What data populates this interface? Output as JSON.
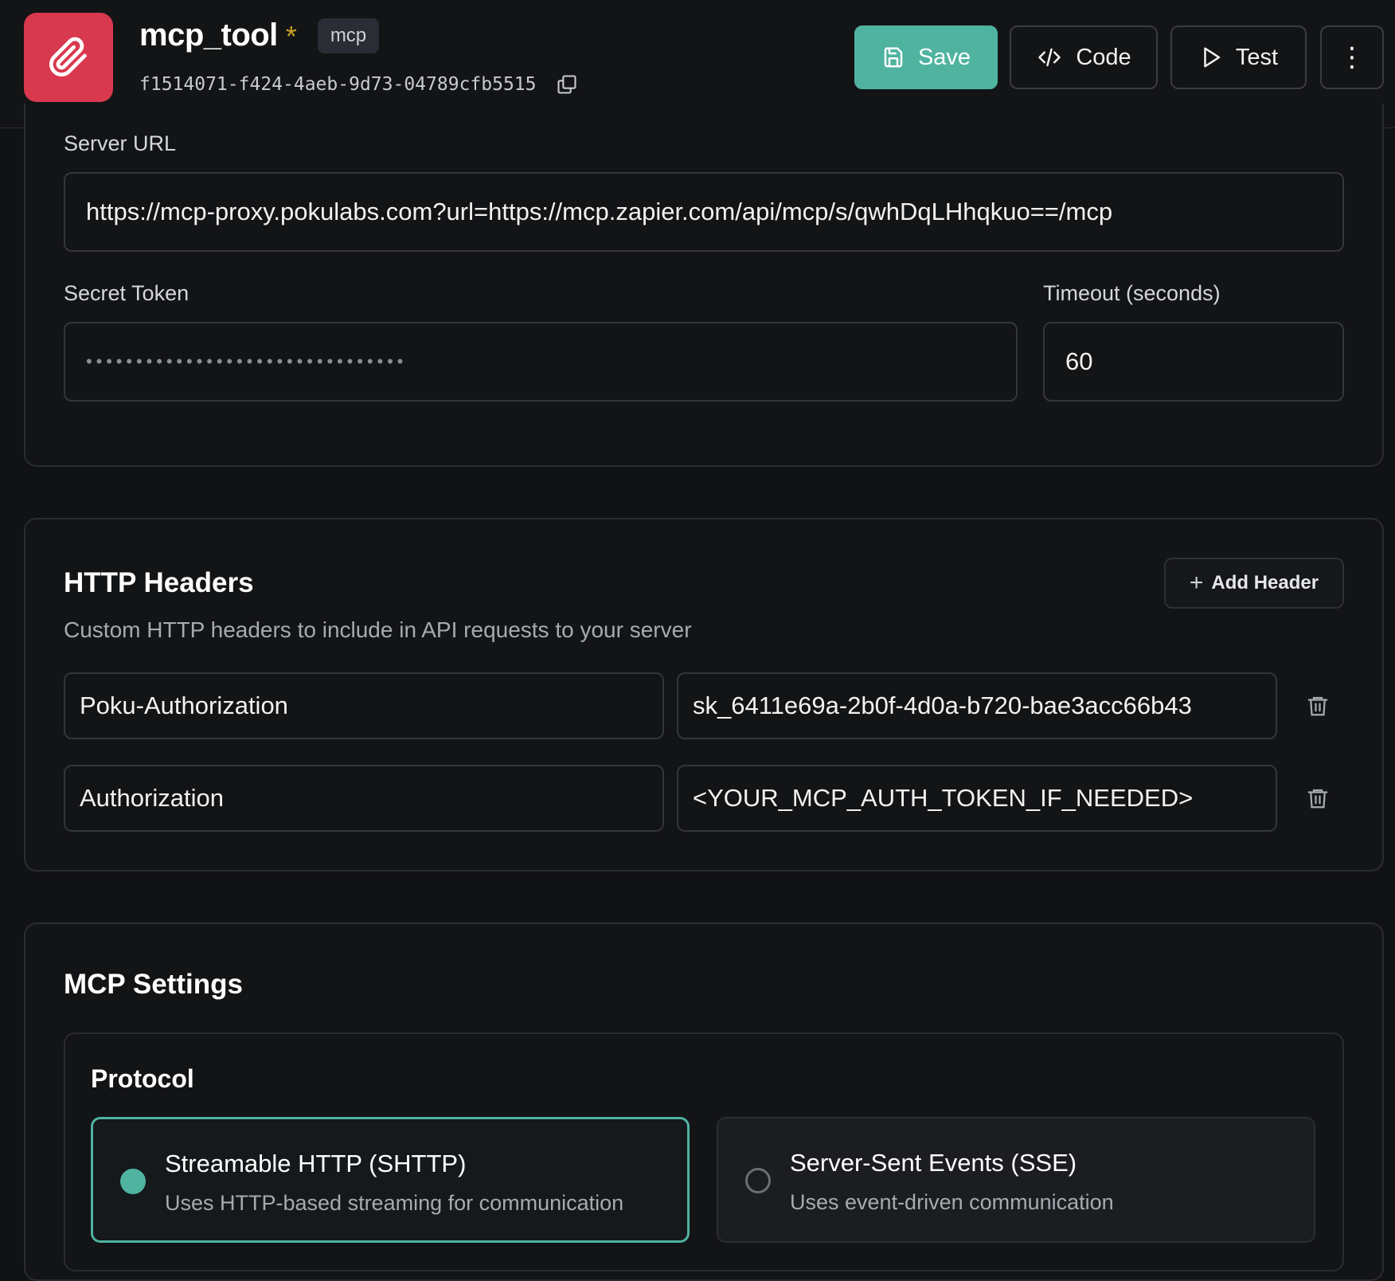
{
  "header": {
    "tool_name": "mcp_tool",
    "unsaved_marker": "*",
    "type_badge": "mcp",
    "tool_id": "f1514071-f424-4aeb-9d73-04789cfb5515",
    "app_icon": "paperclip-icon",
    "save_label": "Save",
    "code_label": "Code",
    "test_label": "Test",
    "more_label": "⋮"
  },
  "connection": {
    "server_url_label": "Server URL",
    "server_url_value": "https://mcp-proxy.pokulabs.com?url=https://mcp.zapier.com/api/mcp/s/qwhDqLHhqkuo==/mcp",
    "secret_token_label": "Secret Token",
    "secret_token_masked": "••••••••••••••••••••••••••••••••",
    "timeout_label": "Timeout (seconds)",
    "timeout_value": "60"
  },
  "http_headers": {
    "title": "HTTP Headers",
    "description": "Custom HTTP headers to include in API requests to your server",
    "add_label": "Add Header",
    "rows": [
      {
        "key": "Poku-Authorization",
        "value": "sk_6411e69a-2b0f-4d0a-b720-bae3acc66b43"
      },
      {
        "key": "Authorization",
        "value": "<YOUR_MCP_AUTH_TOKEN_IF_NEEDED>"
      }
    ]
  },
  "mcp_settings": {
    "title": "MCP Settings",
    "protocol_label": "Protocol",
    "options": [
      {
        "title": "Streamable HTTP (SHTTP)",
        "description": "Uses HTTP-based streaming for communication",
        "selected": true
      },
      {
        "title": "Server-Sent Events (SSE)",
        "description": "Uses event-driven communication",
        "selected": false
      }
    ]
  },
  "colors": {
    "accent": "#4fb3a0",
    "app_icon_bg": "#d9394e",
    "background": "#111214",
    "unsaved_marker": "#c9a227"
  }
}
